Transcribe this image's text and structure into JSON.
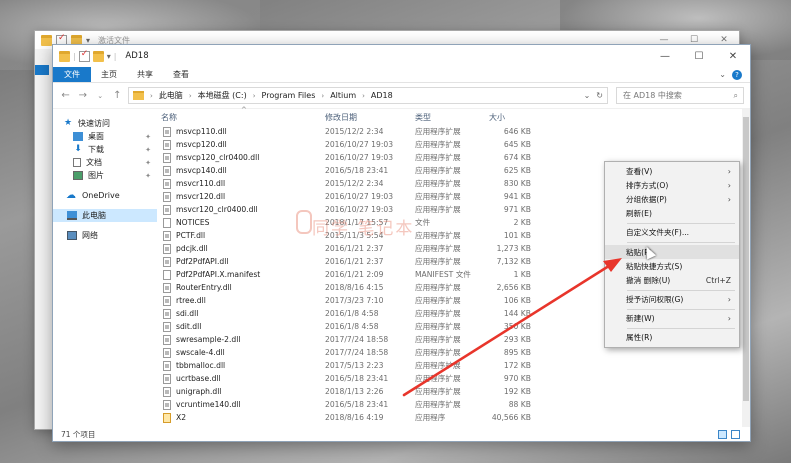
{
  "back_window": {
    "title": "激活文件"
  },
  "window": {
    "title": "AD18",
    "controls": {
      "minimize": "—",
      "maximize": "☐",
      "close": "✕"
    }
  },
  "ribbon": {
    "tabs": [
      "文件",
      "主页",
      "共享",
      "查看"
    ]
  },
  "address_bar": {
    "segments": [
      "此电脑",
      "本地磁盘 (C:)",
      "Program Files",
      "Altium",
      "AD18"
    ],
    "search_placeholder": "在 AD18 中搜索"
  },
  "sidebar": {
    "items": [
      {
        "label": "快速访问",
        "icon": "star-icon"
      },
      {
        "label": "桌面",
        "icon": "desktop-icon",
        "pinned": true
      },
      {
        "label": "下载",
        "icon": "download-icon",
        "pinned": true
      },
      {
        "label": "文档",
        "icon": "document-icon",
        "pinned": true
      },
      {
        "label": "图片",
        "icon": "picture-icon",
        "pinned": true
      },
      {
        "label": "OneDrive",
        "icon": "cloud-icon"
      },
      {
        "label": "此电脑",
        "icon": "computer-icon"
      },
      {
        "label": "网络",
        "icon": "network-icon"
      }
    ]
  },
  "columns": {
    "name": "名称",
    "date": "修改日期",
    "type": "类型",
    "size": "大小"
  },
  "files": [
    {
      "name": "msvcp110.dll",
      "date": "2015/12/2 2:34",
      "type": "应用程序扩展",
      "size": "646 KB",
      "kind": "dll"
    },
    {
      "name": "msvcp120.dll",
      "date": "2016/10/27 19:03",
      "type": "应用程序扩展",
      "size": "645 KB",
      "kind": "dll"
    },
    {
      "name": "msvcp120_clr0400.dll",
      "date": "2016/10/27 19:03",
      "type": "应用程序扩展",
      "size": "674 KB",
      "kind": "dll"
    },
    {
      "name": "msvcp140.dll",
      "date": "2016/5/18 23:41",
      "type": "应用程序扩展",
      "size": "625 KB",
      "kind": "dll"
    },
    {
      "name": "msvcr110.dll",
      "date": "2015/12/2 2:34",
      "type": "应用程序扩展",
      "size": "830 KB",
      "kind": "dll"
    },
    {
      "name": "msvcr120.dll",
      "date": "2016/10/27 19:03",
      "type": "应用程序扩展",
      "size": "941 KB",
      "kind": "dll"
    },
    {
      "name": "msvcr120_clr0400.dll",
      "date": "2016/10/27 19:03",
      "type": "应用程序扩展",
      "size": "971 KB",
      "kind": "dll"
    },
    {
      "name": "NOTICES",
      "date": "2018/1/17 15:57",
      "type": "文件",
      "size": "2 KB",
      "kind": "file"
    },
    {
      "name": "PCTF.dll",
      "date": "2015/11/3 5:54",
      "type": "应用程序扩展",
      "size": "101 KB",
      "kind": "dll"
    },
    {
      "name": "pdcjk.dll",
      "date": "2016/1/21 2:37",
      "type": "应用程序扩展",
      "size": "1,273 KB",
      "kind": "dll"
    },
    {
      "name": "Pdf2PdfAPI.dll",
      "date": "2016/1/21 2:37",
      "type": "应用程序扩展",
      "size": "7,132 KB",
      "kind": "dll"
    },
    {
      "name": "Pdf2PdfAPI.X.manifest",
      "date": "2016/1/21 2:09",
      "type": "MANIFEST 文件",
      "size": "1 KB",
      "kind": "file"
    },
    {
      "name": "RouterEntry.dll",
      "date": "2018/8/16 4:15",
      "type": "应用程序扩展",
      "size": "2,656 KB",
      "kind": "dll"
    },
    {
      "name": "rtree.dll",
      "date": "2017/3/23 7:10",
      "type": "应用程序扩展",
      "size": "106 KB",
      "kind": "dll"
    },
    {
      "name": "sdi.dll",
      "date": "2016/1/8 4:58",
      "type": "应用程序扩展",
      "size": "144 KB",
      "kind": "dll"
    },
    {
      "name": "sdit.dll",
      "date": "2016/1/8 4:58",
      "type": "应用程序扩展",
      "size": "350 KB",
      "kind": "dll"
    },
    {
      "name": "swresample-2.dll",
      "date": "2017/7/24 18:58",
      "type": "应用程序扩展",
      "size": "293 KB",
      "kind": "dll"
    },
    {
      "name": "swscale-4.dll",
      "date": "2017/7/24 18:58",
      "type": "应用程序扩展",
      "size": "895 KB",
      "kind": "dll"
    },
    {
      "name": "tbbmalloc.dll",
      "date": "2017/5/13 2:23",
      "type": "应用程序扩展",
      "size": "172 KB",
      "kind": "dll"
    },
    {
      "name": "ucrtbase.dll",
      "date": "2016/5/18 23:41",
      "type": "应用程序扩展",
      "size": "970 KB",
      "kind": "dll"
    },
    {
      "name": "unigraph.dll",
      "date": "2018/1/13 2:26",
      "type": "应用程序扩展",
      "size": "192 KB",
      "kind": "dll"
    },
    {
      "name": "vcruntime140.dll",
      "date": "2016/5/18 23:41",
      "type": "应用程序扩展",
      "size": "88 KB",
      "kind": "dll"
    },
    {
      "name": "X2",
      "date": "2018/8/16 4:19",
      "type": "应用程序",
      "size": "40,566 KB",
      "kind": "exe"
    }
  ],
  "status": {
    "count": "71 个项目"
  },
  "watermark": "同学 笔记本",
  "context_menu": [
    {
      "label": "查看(V)",
      "submenu": true
    },
    {
      "label": "排序方式(O)",
      "submenu": true
    },
    {
      "label": "分组依据(P)",
      "submenu": true
    },
    {
      "label": "刷新(E)"
    },
    {
      "sep": true
    },
    {
      "label": "自定义文件夹(F)..."
    },
    {
      "sep": true
    },
    {
      "label": "粘贴(P)",
      "hover": true
    },
    {
      "label": "粘贴快捷方式(S)"
    },
    {
      "label": "撤消 删除(U)",
      "shortcut": "Ctrl+Z"
    },
    {
      "sep": true
    },
    {
      "label": "授予访问权限(G)",
      "submenu": true
    },
    {
      "sep": true
    },
    {
      "label": "新建(W)",
      "submenu": true
    },
    {
      "sep": true
    },
    {
      "label": "属性(R)"
    }
  ],
  "colors": {
    "accent": "#1979ca",
    "arrow": "#e8352b"
  }
}
